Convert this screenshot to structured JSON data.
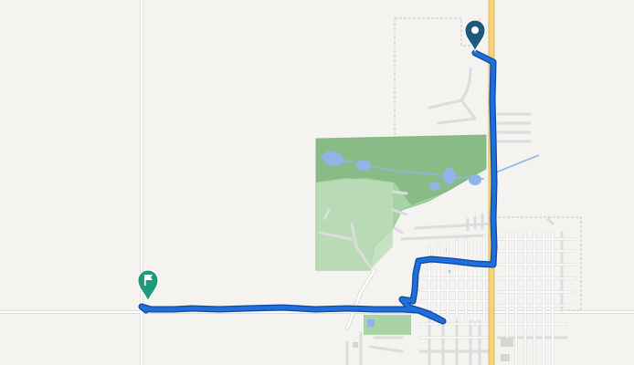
{
  "map": {
    "colors": {
      "land": "#f4f3ef",
      "park": "#a9d3a6",
      "park_dark": "#6ea86b",
      "water": "#8fb4e6",
      "road": "#ffffff",
      "road_casing": "#cfcfcf",
      "highway": "#f7d27a",
      "highway_casing": "#d8b968",
      "boundary": "#c6c6c6",
      "route": "#1e6fd9",
      "route_outline": "#0d47a1",
      "start_marker": "#1f5a7a",
      "end_marker": "#1f9a7a"
    },
    "route": {
      "description": "",
      "start_marker_icon": "location-pin-icon",
      "end_marker_icon": "flag-pin-icon"
    }
  }
}
